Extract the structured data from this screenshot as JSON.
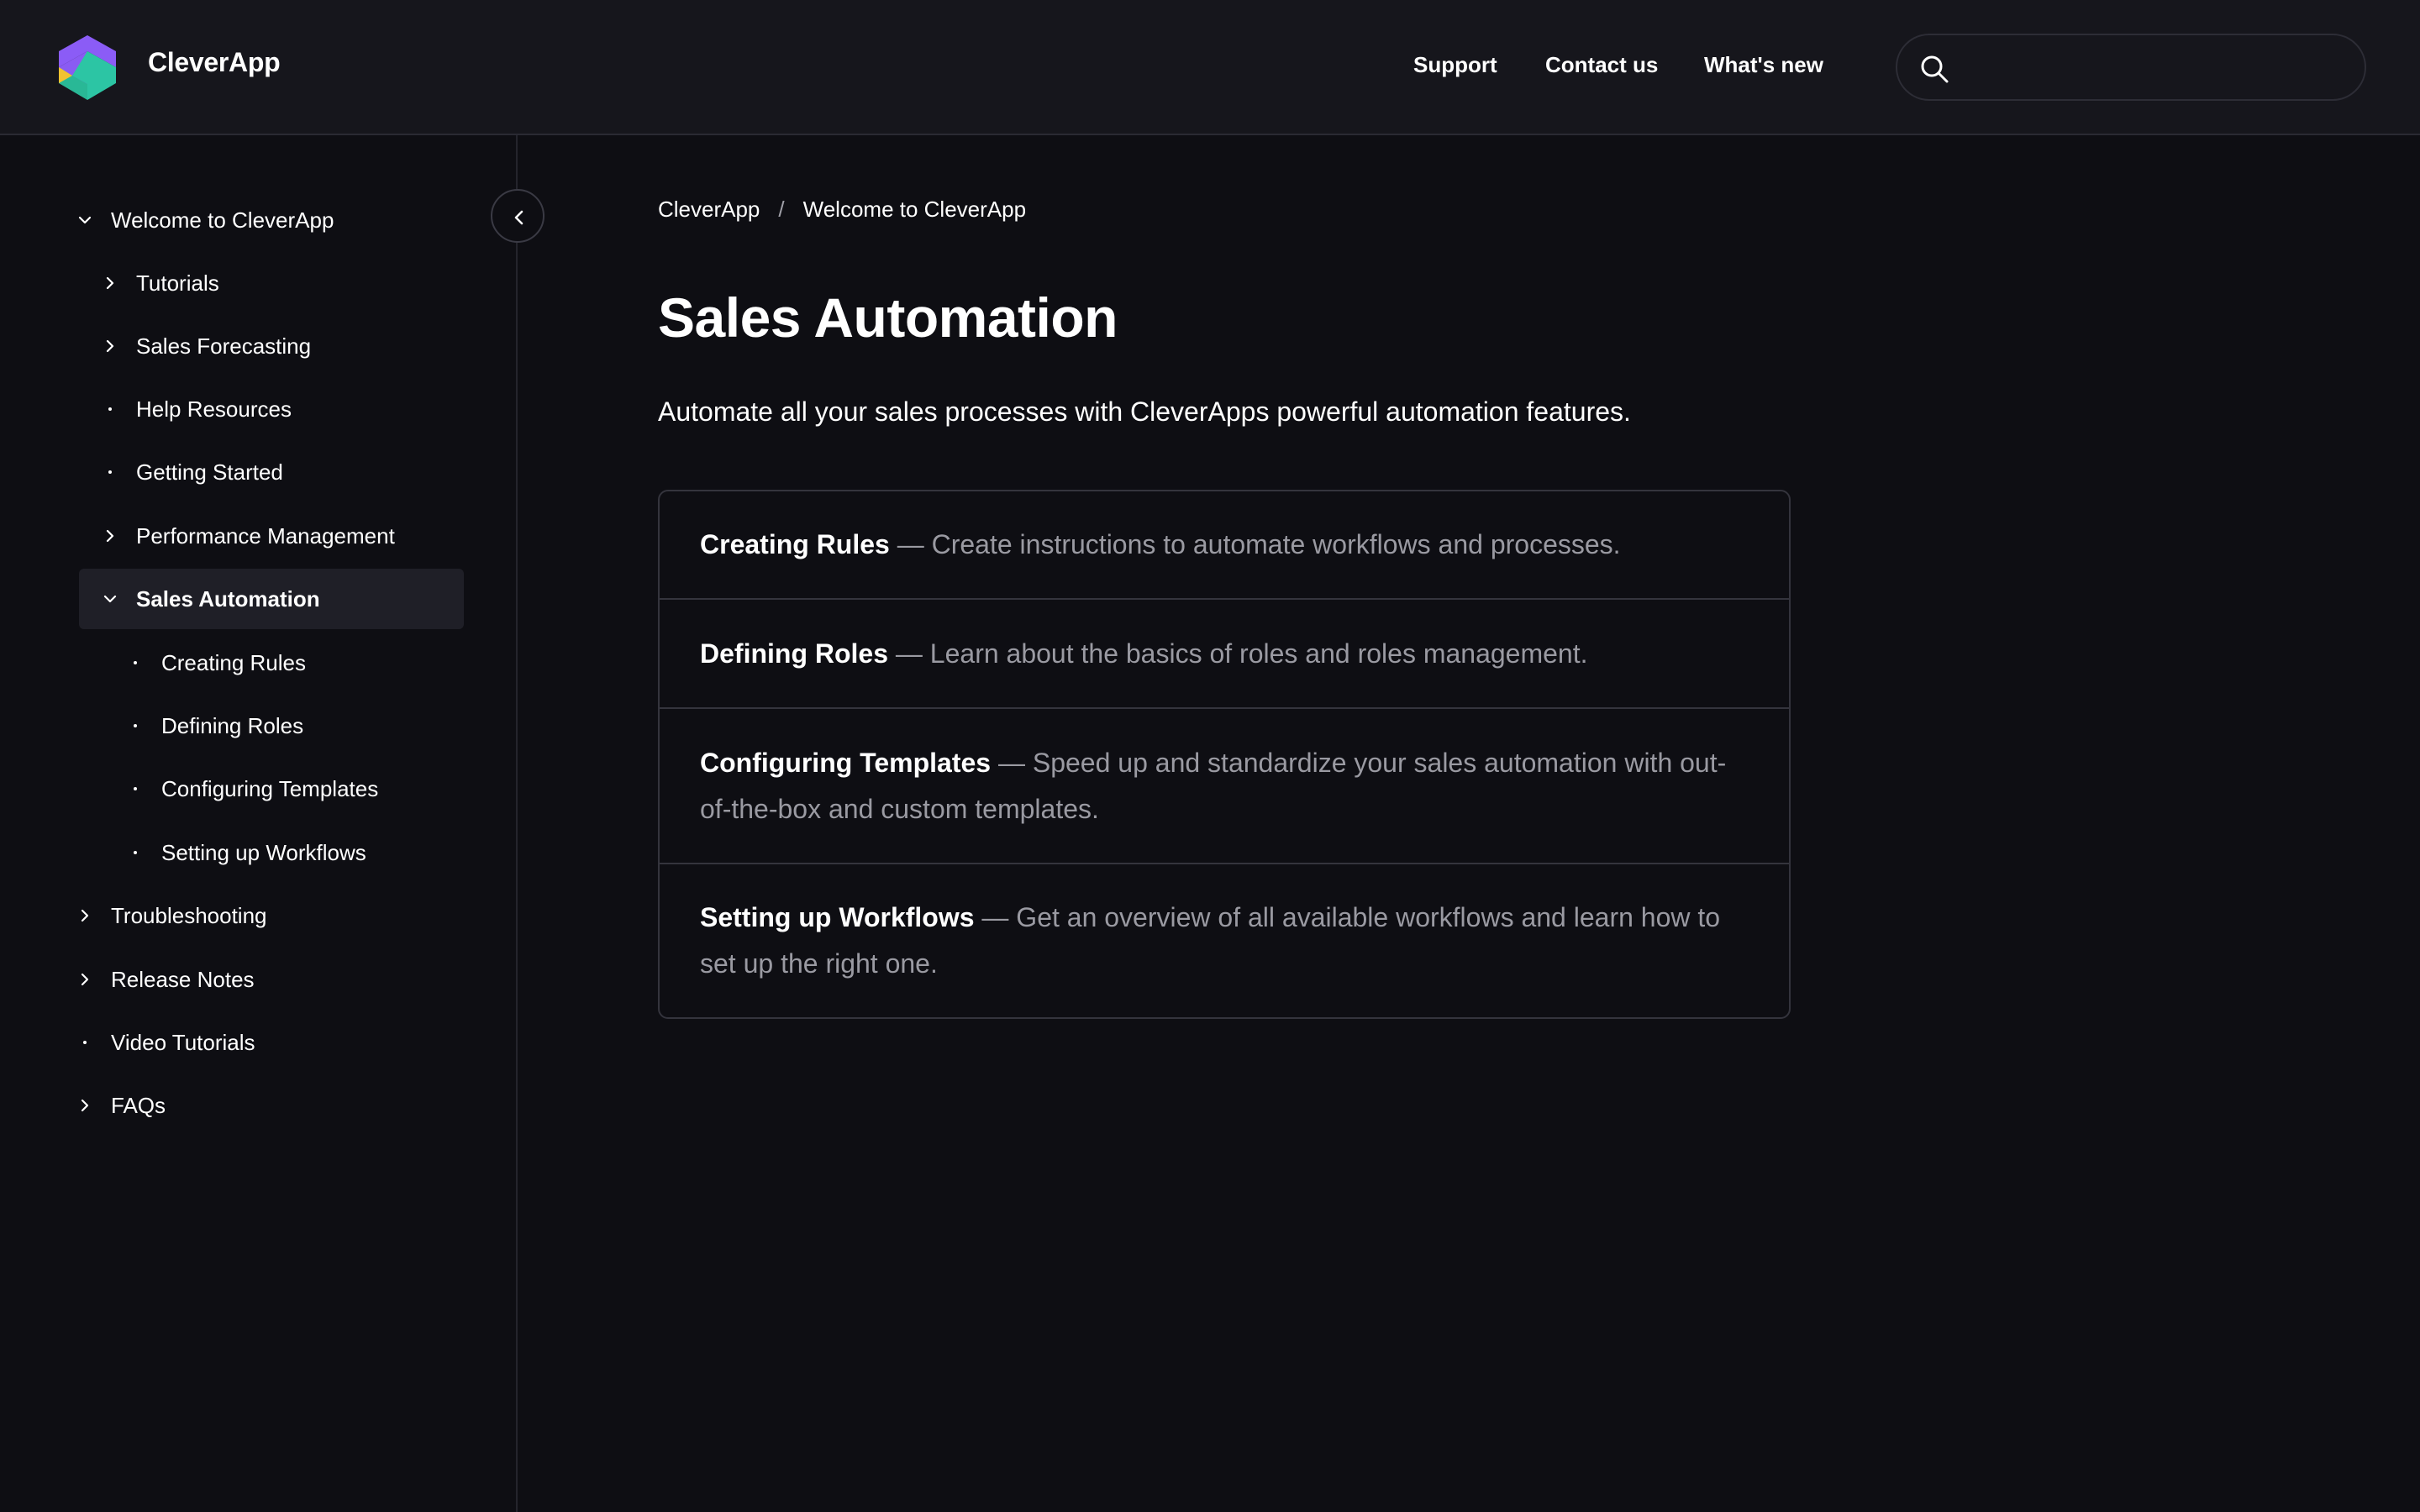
{
  "header": {
    "brand": "CleverApp",
    "nav": [
      {
        "label": "Support"
      },
      {
        "label": "Contact us"
      },
      {
        "label": "What's new"
      }
    ],
    "search": {
      "value": "",
      "placeholder": ""
    }
  },
  "sidebar": {
    "items": [
      {
        "label": "Welcome to CleverApp",
        "icon": "chevron-down-icon"
      },
      {
        "label": "Tutorials",
        "icon": "chevron-right-icon"
      },
      {
        "label": "Sales Forecasting",
        "icon": "chevron-right-icon"
      },
      {
        "label": "Help Resources",
        "icon": "dot-icon"
      },
      {
        "label": "Getting Started",
        "icon": "dot-icon"
      },
      {
        "label": "Performance Management",
        "icon": "chevron-right-icon"
      },
      {
        "label": "Sales Automation",
        "icon": "chevron-down-icon",
        "active": true
      },
      {
        "label": "Creating Rules",
        "icon": "dot-icon"
      },
      {
        "label": "Defining Roles",
        "icon": "dot-icon"
      },
      {
        "label": "Configuring Templates",
        "icon": "dot-icon"
      },
      {
        "label": "Setting up Workflows",
        "icon": "dot-icon"
      },
      {
        "label": "Troubleshooting",
        "icon": "chevron-right-icon"
      },
      {
        "label": "Release Notes",
        "icon": "chevron-right-icon"
      },
      {
        "label": "Video Tutorials",
        "icon": "dot-icon"
      },
      {
        "label": "FAQs",
        "icon": "chevron-right-icon"
      }
    ]
  },
  "breadcrumb": {
    "items": [
      "CleverApp",
      "Welcome to CleverApp"
    ],
    "separator": "/"
  },
  "main": {
    "title": "Sales Automation",
    "subtitle": "Automate all your sales processes with CleverApps powerful automation features.",
    "cards": [
      {
        "title": "Creating Rules",
        "desc": " — Create instructions to automate workflows and processes."
      },
      {
        "title": "Defining Roles",
        "desc": " — Learn about the basics of roles and roles management."
      },
      {
        "title": "Configuring Templates",
        "desc": " — Speed up and standardize your sales automation with out-of-the-box and custom templates."
      },
      {
        "title": "Setting up Workflows",
        "desc": " — Get an overview of all available workflows and learn how to set up the right one."
      }
    ]
  },
  "colors": {
    "background": "#0e0e13",
    "header": "#16161c",
    "active_item": "#1f1f27",
    "muted_text": "#9a9aa2",
    "logo_purple": "#8b5cf6",
    "logo_teal": "#2cc5a4",
    "logo_yellow": "#f2c230"
  }
}
